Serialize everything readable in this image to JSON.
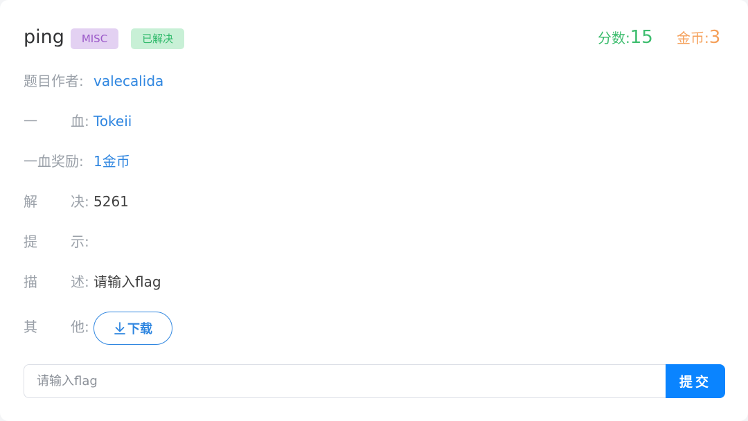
{
  "challenge": {
    "title": "ping",
    "category_tag": "MISC",
    "status_tag": "已解决",
    "points_label": "分数:",
    "points_value": "15",
    "coins_label": "金币:",
    "coins_value": "3"
  },
  "details": {
    "author_label": "题目作者:",
    "author_value": "valecalida",
    "first_blood_label_1": "一",
    "first_blood_label_2": "血",
    "first_blood_value": "Tokeii",
    "first_blood_reward_label": "一血奖励:",
    "first_blood_reward_value": "1金币",
    "solves_label_1": "解",
    "solves_label_2": "决",
    "solves_value": "5261",
    "hint_label_1": "提",
    "hint_label_2": "示",
    "hint_value": "",
    "description_label_1": "描",
    "description_label_2": "述",
    "description_value": "请输入flag",
    "other_label_1": "其",
    "other_label_2": "他",
    "colon": ":",
    "download_label": "下载"
  },
  "submission": {
    "placeholder": "请输入flag",
    "submit_label": "提交"
  },
  "colors": {
    "link": "#2f86e0",
    "points": "#3dbd6e",
    "coins": "#f5a05a",
    "submit": "#0a84ff"
  },
  "icons": {
    "download": "download-arrow-icon"
  }
}
